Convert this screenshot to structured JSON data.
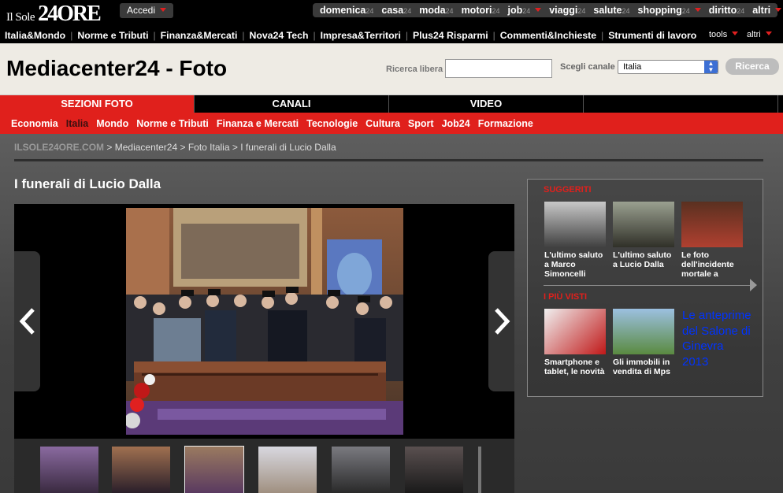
{
  "top": {
    "logo_small": "Il Sole",
    "logo_big": "24ORE",
    "login_label": "Accedi",
    "brands": [
      {
        "name": "domenica",
        "suffix": "24"
      },
      {
        "name": "casa",
        "suffix": "24"
      },
      {
        "name": "moda",
        "suffix": "24"
      },
      {
        "name": "motori",
        "suffix": "24"
      },
      {
        "name": "job",
        "suffix": "24"
      },
      {
        "name": "viaggi",
        "suffix": "24"
      },
      {
        "name": "salute",
        "suffix": "24"
      },
      {
        "name": "shopping",
        "suffix": "24"
      },
      {
        "name": "diritto",
        "suffix": "24"
      },
      {
        "name": "altri",
        "suffix": ""
      }
    ]
  },
  "nav": {
    "items": [
      "Italia&Mondo",
      "Norme e Tributi",
      "Finanza&Mercati",
      "Nova24 Tech",
      "Impresa&Territori",
      "Plus24 Risparmi",
      "Commenti&Inchieste",
      "Strumenti di lavoro"
    ],
    "tools_label": "tools",
    "altri_label": "altri"
  },
  "header": {
    "title": "Mediacenter24 - Foto",
    "search_label": "Ricerca libera",
    "search_value": "",
    "channel_label": "Scegli canale",
    "channel_value": "Italia",
    "search_button": "Ricerca"
  },
  "tabs": [
    {
      "label": "SEZIONI FOTO",
      "active": true
    },
    {
      "label": "CANALI",
      "active": false
    },
    {
      "label": "VIDEO",
      "active": false
    },
    {
      "label": "",
      "active": false
    }
  ],
  "subnav": [
    "Economia",
    "Italia",
    "Mondo",
    "Norme e Tributi",
    "Finanza e Mercati",
    "Tecnologie",
    "Cultura",
    "Sport",
    "Job24",
    "Formazione"
  ],
  "subnav_current": "Italia",
  "breadcrumb": {
    "home": "ILSOLE24ORE.COM",
    "sep": ">",
    "items": [
      "Mediacenter24",
      "Foto Italia",
      "I funerali di Lucio Dalla"
    ]
  },
  "gallery": {
    "title": "I funerali di Lucio Dalla",
    "selected_thumb": 2
  },
  "sidebar": {
    "suggested_title": "SUGGERITI",
    "suggested": [
      {
        "caption": "L'ultimo saluto a Marco Simoncelli"
      },
      {
        "caption": "L'ultimo saluto a Lucio Dalla"
      },
      {
        "caption": "Le foto dell'incidente mortale a"
      }
    ],
    "most_viewed_title": "I PIÙ VISTI",
    "most_viewed": [
      {
        "caption": "Smartphone e tablet, le novità"
      },
      {
        "caption": "Gli immobili in vendita di Mps"
      }
    ],
    "big_link": "Le anteprime del Salone di Ginevra 2013"
  },
  "colors": {
    "accent_red": "#e0201c",
    "link_blue": "#0033ff"
  }
}
